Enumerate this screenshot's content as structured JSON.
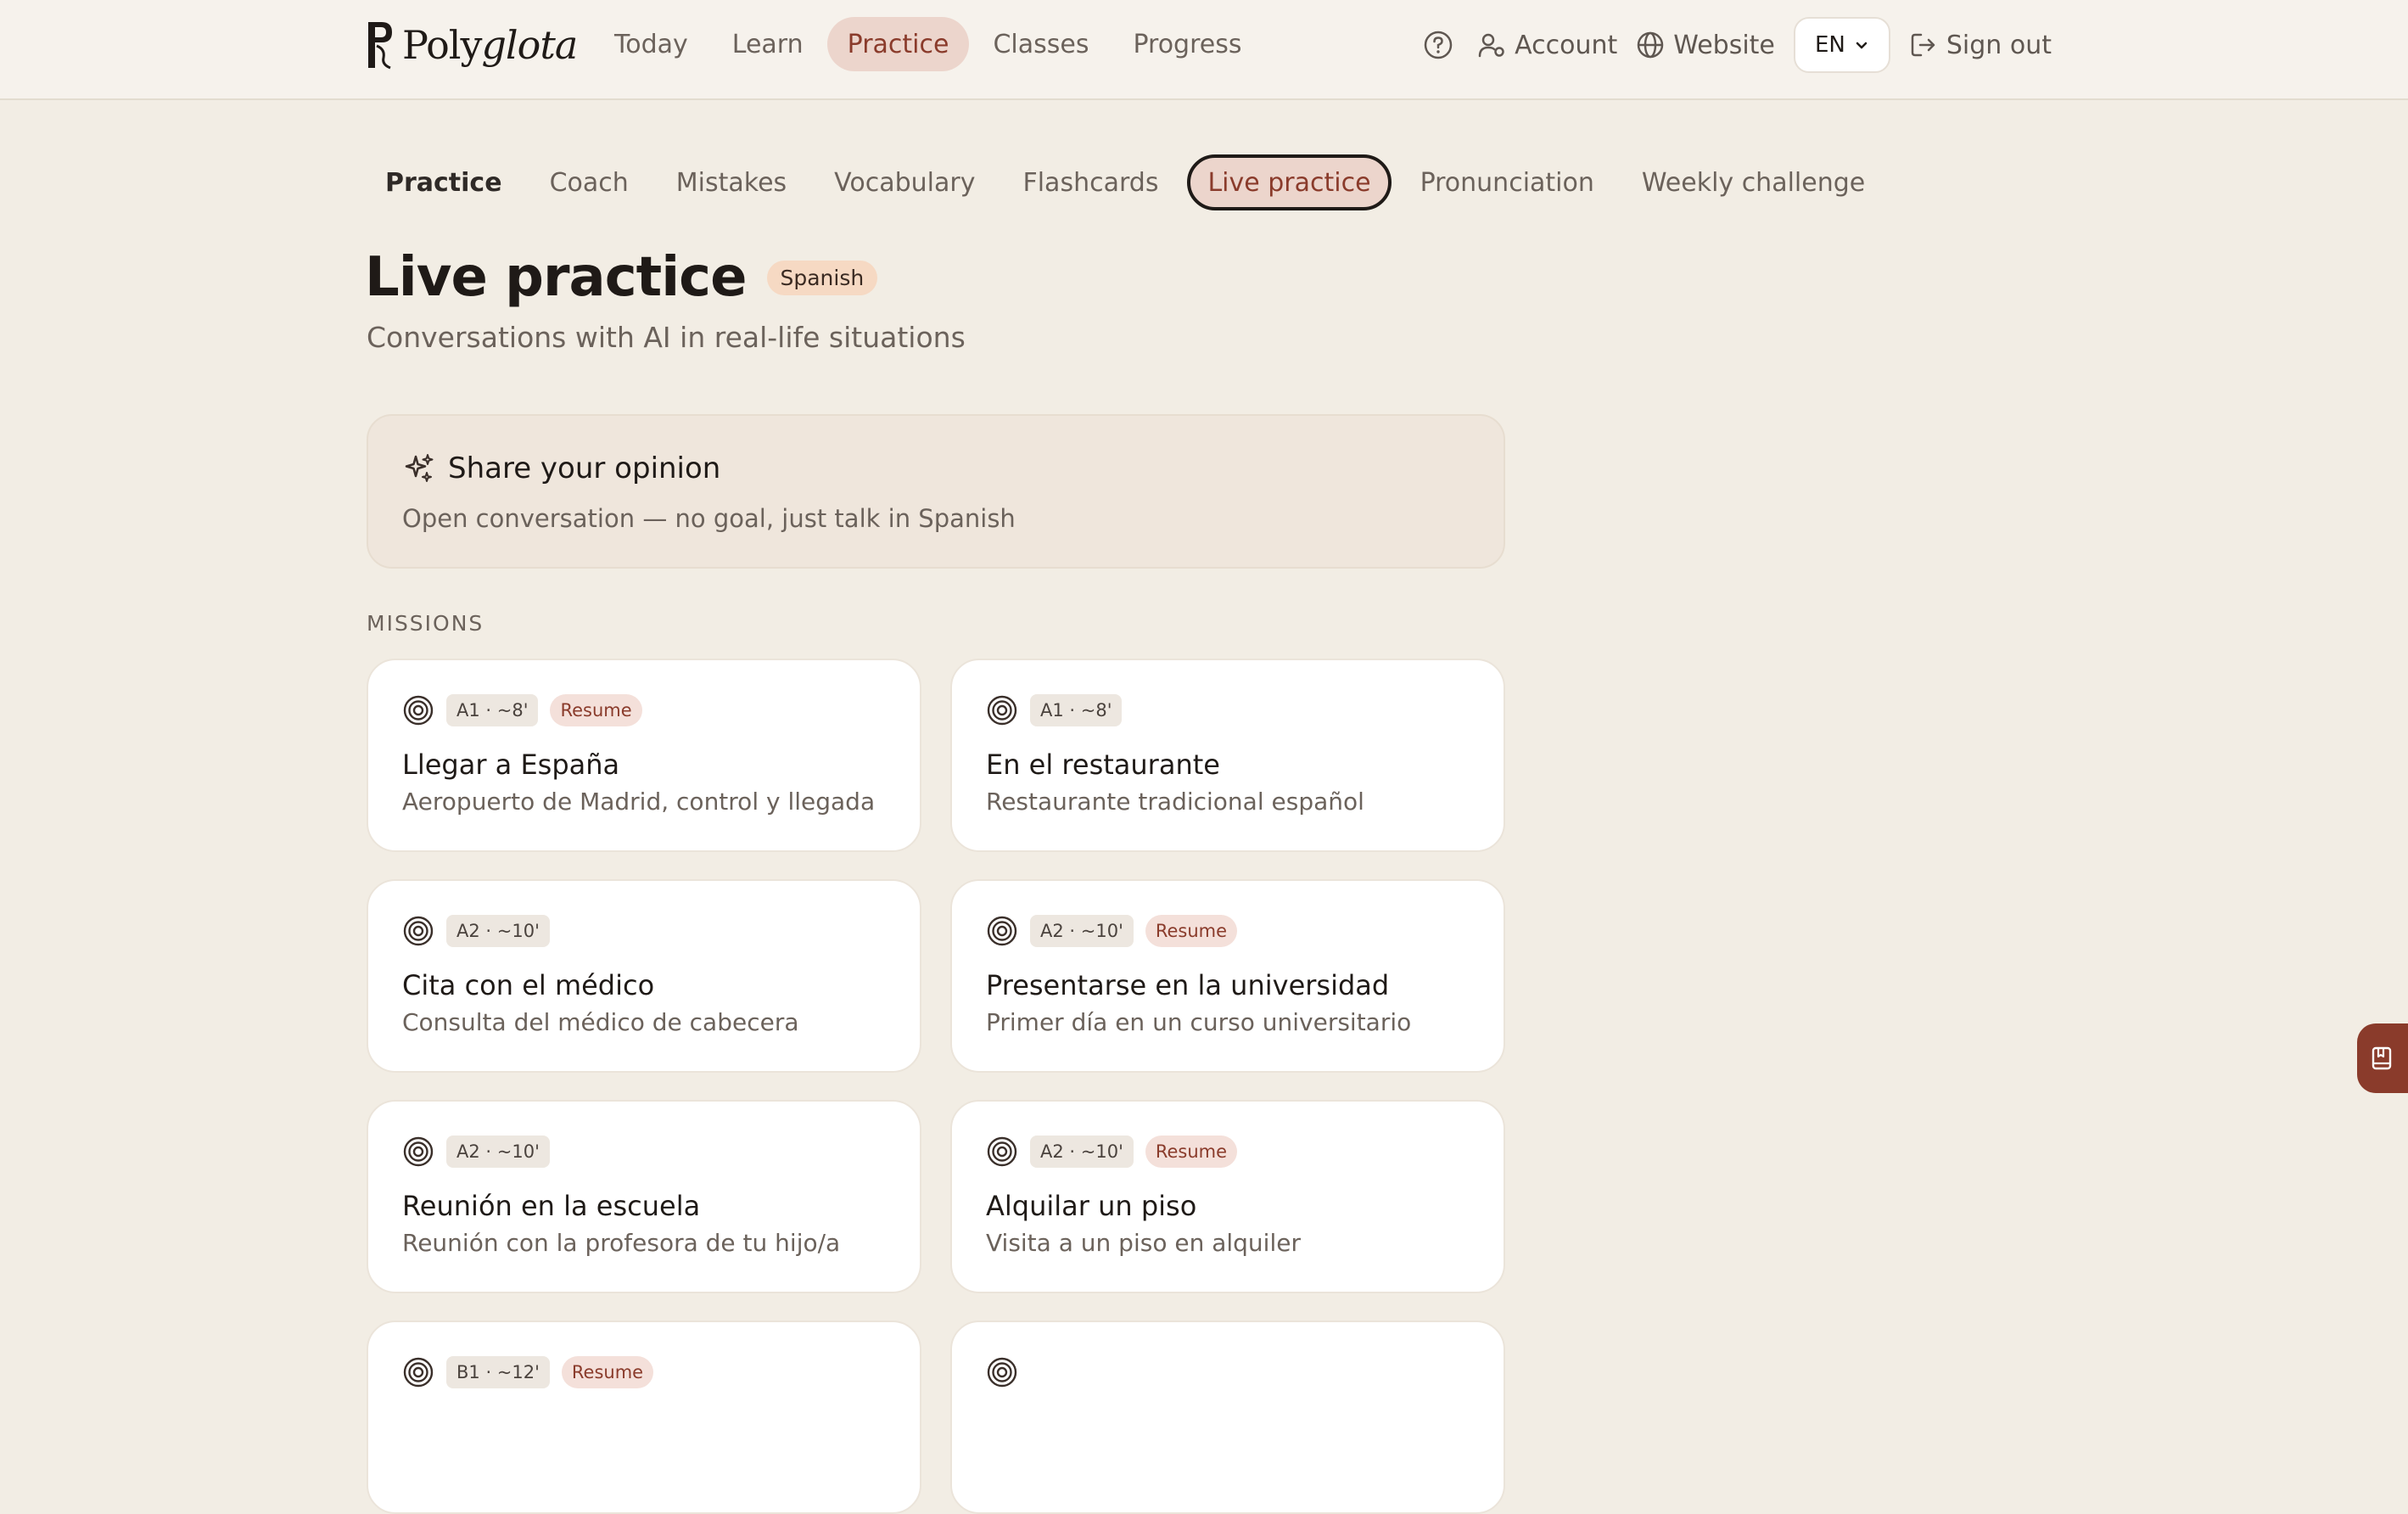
{
  "brand": {
    "name_regular": "Poly",
    "name_italic": "glota"
  },
  "main_nav": {
    "items": [
      {
        "label": "Today"
      },
      {
        "label": "Learn"
      },
      {
        "label": "Practice",
        "active": true
      },
      {
        "label": "Classes"
      },
      {
        "label": "Progress"
      }
    ]
  },
  "top_actions": {
    "help_icon": "question-circle-icon",
    "account_label": "Account",
    "website_label": "Website",
    "language_value": "EN",
    "signout_label": "Sign out"
  },
  "sub_nav": {
    "items": [
      {
        "label": "Practice"
      },
      {
        "label": "Coach"
      },
      {
        "label": "Mistakes"
      },
      {
        "label": "Vocabulary"
      },
      {
        "label": "Flashcards"
      },
      {
        "label": "Live practice",
        "active": true
      },
      {
        "label": "Pronunciation"
      },
      {
        "label": "Weekly challenge"
      }
    ]
  },
  "header": {
    "title": "Live practice",
    "language_badge": "Spanish",
    "subtitle": "Conversations with AI in real-life situations"
  },
  "opinion_card": {
    "title": "Share your opinion",
    "description": "Open conversation — no goal, just talk in Spanish"
  },
  "missions": {
    "section_label": "MISSIONS",
    "resume_label": "Resume",
    "items": [
      {
        "level": "A1 · ~8'",
        "resume": true,
        "title": "Llegar a España",
        "desc": "Aeropuerto de Madrid, control y llegada"
      },
      {
        "level": "A1 · ~8'",
        "resume": false,
        "title": "En el restaurante",
        "desc": "Restaurante tradicional español"
      },
      {
        "level": "A2 · ~10'",
        "resume": false,
        "title": "Cita con el médico",
        "desc": "Consulta del médico de cabecera"
      },
      {
        "level": "A2 · ~10'",
        "resume": true,
        "title": "Presentarse en la universidad",
        "desc": "Primer día en un curso universitario"
      },
      {
        "level": "A2 · ~10'",
        "resume": false,
        "title": "Reunión en la escuela",
        "desc": "Reunión con la profesora de tu hijo/a"
      },
      {
        "level": "A2 · ~10'",
        "resume": true,
        "title": "Alquilar un piso",
        "desc": "Visita a un piso en alquiler"
      },
      {
        "level": "B1 · ~12'",
        "resume": true,
        "title": "",
        "desc": ""
      },
      {
        "level": "",
        "resume": false,
        "title": "",
        "desc": ""
      }
    ]
  },
  "colors": {
    "accent": "#8a3b2b",
    "accent_bg": "#ecd5cc",
    "page_bg": "#f2ede4",
    "badge_bg": "#f6d9c3"
  },
  "floating_tab_icon": "bookmark-book-icon"
}
